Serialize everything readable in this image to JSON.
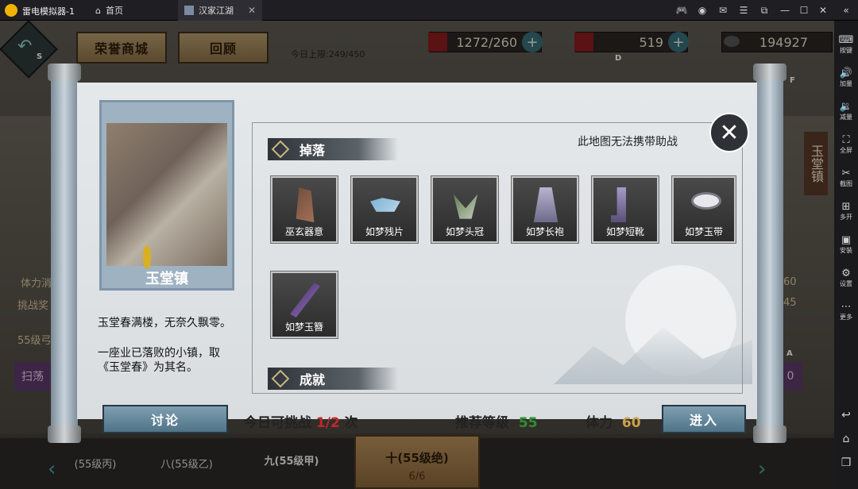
{
  "emulator": {
    "title": "雷电模拟器-1",
    "tabs": [
      {
        "label": "首页"
      },
      {
        "label": "汉家江湖"
      }
    ],
    "sidebar": [
      "按键",
      "加量",
      "减量",
      "全屏",
      "截图",
      "多开",
      "安装",
      "设置",
      "更多"
    ]
  },
  "game": {
    "top_buttons": {
      "honor_shop": "荣誉商城",
      "review": "回顾"
    },
    "daily_limit": "今日上限:249/450",
    "resources": {
      "stamina": "1272/260",
      "gems": "519",
      "coins": "194927"
    },
    "hotkeys": {
      "s": "S",
      "d": "D",
      "f": "F",
      "a": "A"
    },
    "side_labels": {
      "left_1": "体力消",
      "left_2": "挑战奖",
      "left_3": "55级弓",
      "left_4": "扫荡",
      "right_1": "60",
      "right_2": "45",
      "right_3": "0",
      "right_banner": "玉堂镇"
    },
    "bottom_tabs": [
      "(55级丙)",
      "八(55级乙)",
      "九(55级甲)",
      "十(55级绝)"
    ],
    "bottom_progress": "6/6"
  },
  "modal": {
    "map_name": "玉堂镇",
    "description": [
      "玉堂春满楼，无奈久飘零。",
      "一座业已落败的小镇，取《玉堂春》为其名。"
    ],
    "drops_title": "掉落",
    "no_assist_notice": "此地图无法携带助战",
    "items": [
      {
        "name": "巫玄器意",
        "icon": "relic-icon"
      },
      {
        "name": "如梦残片",
        "icon": "shard-icon"
      },
      {
        "name": "如梦头冠",
        "icon": "helmet-icon"
      },
      {
        "name": "如梦长袍",
        "icon": "robe-icon"
      },
      {
        "name": "如梦短靴",
        "icon": "boots-icon"
      },
      {
        "name": "如梦玉带",
        "icon": "belt-icon"
      },
      {
        "name": "如梦玉簪",
        "icon": "hairpin-icon"
      }
    ],
    "achievements_title": "成就",
    "discuss_button": "讨论",
    "challenge_prefix": "今日可挑战",
    "challenge_count": "1/2",
    "challenge_suffix": "次",
    "recommended_level_label": "推荐等级",
    "recommended_level": "55",
    "stamina_label": "体力",
    "stamina_cost": "60",
    "enter_button": "进入",
    "colors": {
      "level": "#2f8f2f",
      "stamina": "#c9a24a",
      "count": "#c0262b"
    }
  }
}
